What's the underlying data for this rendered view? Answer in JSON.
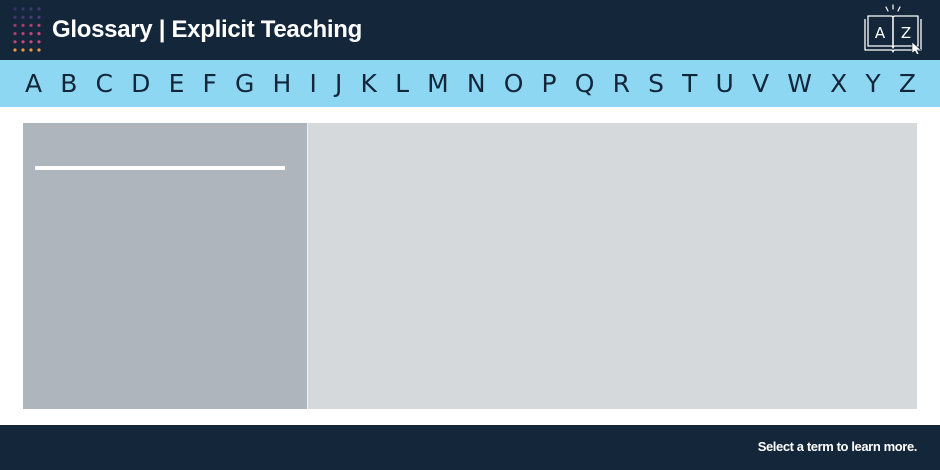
{
  "header": {
    "title": "Glossary | Explicit Teaching",
    "icon": "dot-grid-logo-icon",
    "az_icon": {
      "name": "az-book-icon",
      "letter_a": "A",
      "letter_z": "Z"
    }
  },
  "alphabet": [
    "A",
    "B",
    "C",
    "D",
    "E",
    "F",
    "G",
    "H",
    "I",
    "J",
    "K",
    "L",
    "M",
    "N",
    "O",
    "P",
    "Q",
    "R",
    "S",
    "T",
    "U",
    "V",
    "W",
    "X",
    "Y",
    "Z"
  ],
  "footer": {
    "hint": "Select a term to learn more."
  },
  "colors": {
    "header_bg": "#13263a",
    "alphabar_bg": "#8dd7f2",
    "term_list_bg": "#aeb5bc",
    "definition_bg": "#d5d9dc",
    "dot_purple": "#6b3fa0",
    "dot_pink": "#d9437a",
    "dot_orange": "#f29a3a"
  }
}
